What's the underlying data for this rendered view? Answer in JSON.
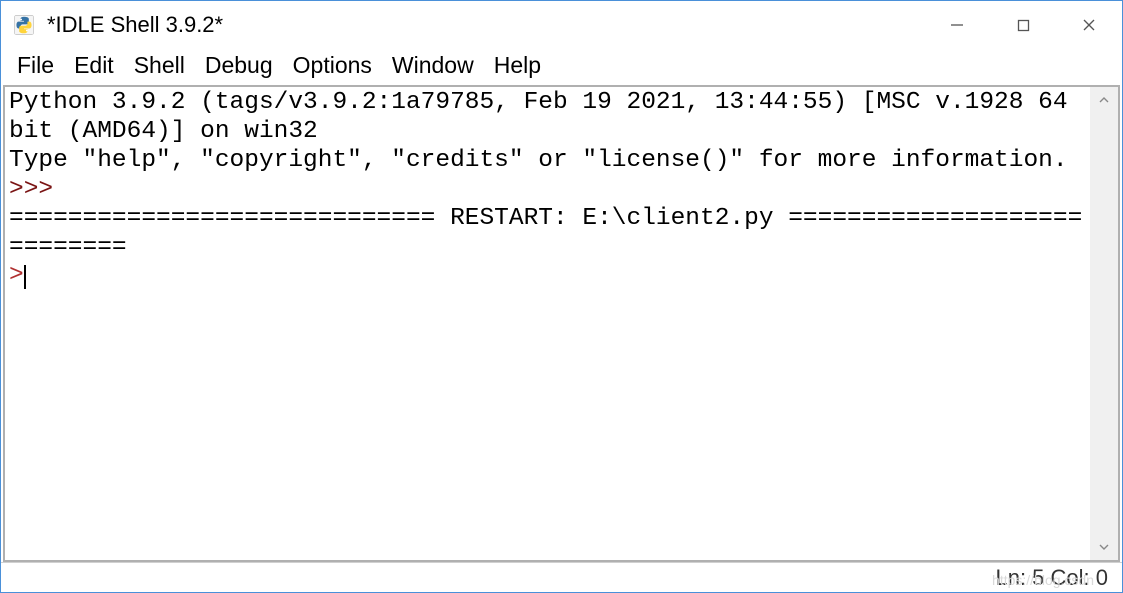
{
  "window": {
    "title": "*IDLE Shell 3.9.2*"
  },
  "menu": {
    "items": [
      "File",
      "Edit",
      "Shell",
      "Debug",
      "Options",
      "Window",
      "Help"
    ]
  },
  "shell": {
    "banner1": "Python 3.9.2 (tags/v3.9.2:1a79785, Feb 19 2021, 13:44:55) [MSC v.1928 64 bit (AMD64)] on win32",
    "banner2": "Type \"help\", \"copyright\", \"credits\" or \"license()\" for more information.",
    "prompt1": ">>> ",
    "restart_line": "============================= RESTART: E:\\client2.py ============================",
    "input_prompt": ">"
  },
  "status": {
    "position": "Ln: 5 Col: 0"
  },
  "watermark": "https://blog.csdn"
}
